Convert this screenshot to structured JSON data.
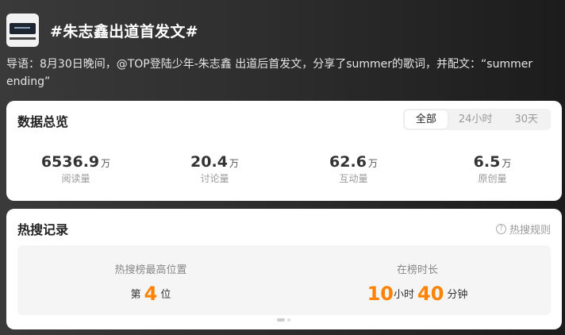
{
  "topic": {
    "title": "#朱志鑫出道首发文#",
    "lead": "导语：8月30日晚间，@TOP登陆少年-朱志鑫 出道后首发文，分享了summer的歌词，并配文：“summer ending”"
  },
  "overview": {
    "title": "数据总览",
    "tabs": [
      "全部",
      "24小时",
      "30天"
    ],
    "active_tab": "全部",
    "stats": [
      {
        "value": "6536.9",
        "unit": "万",
        "label": "阅读量"
      },
      {
        "value": "20.4",
        "unit": "万",
        "label": "讨论量"
      },
      {
        "value": "62.6",
        "unit": "万",
        "label": "互动量"
      },
      {
        "value": "6.5",
        "unit": "万",
        "label": "原创量"
      }
    ]
  },
  "hot_record": {
    "title": "热搜记录",
    "help_label": "热搜规则",
    "help_icon": "question-circle-icon",
    "highest_label": "热搜榜最高位置",
    "highest_prefix": "第",
    "highest_value": "4",
    "highest_suffix": "位",
    "duration_label": "在榜时长",
    "hours_value": "10",
    "hours_unit": "小时",
    "minutes_value": "40",
    "minutes_unit": "分钟"
  },
  "colors": {
    "accent": "#ff8200",
    "card_bg": "#ffffff"
  }
}
